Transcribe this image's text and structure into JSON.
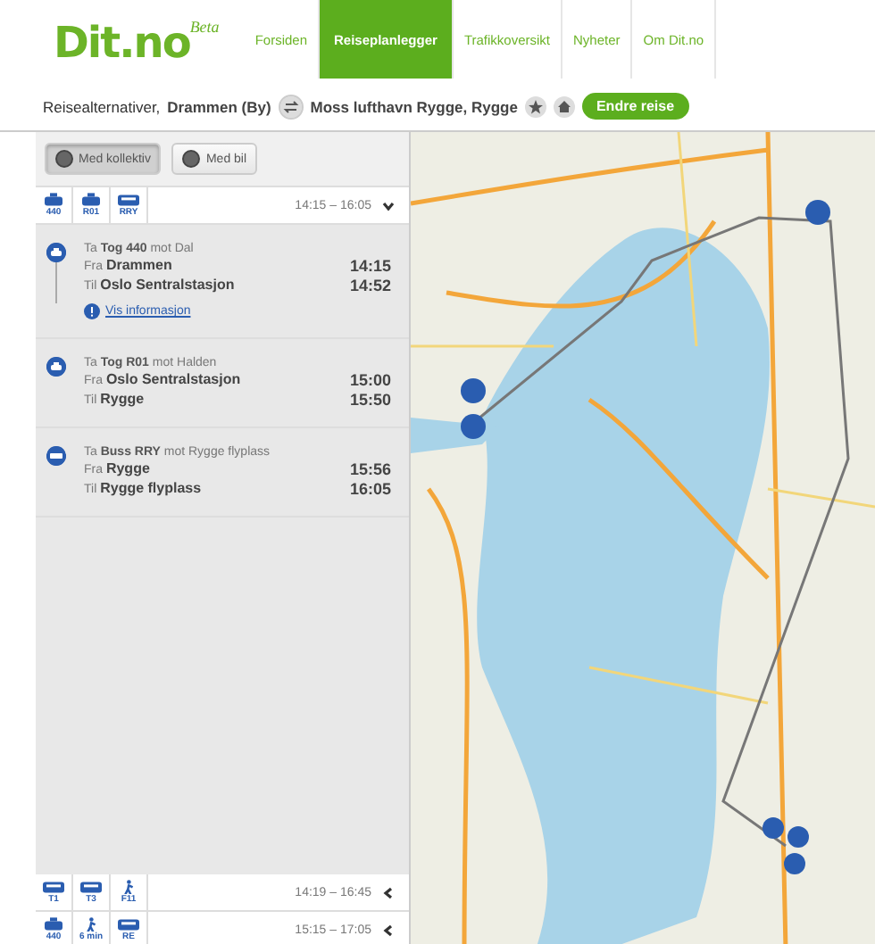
{
  "logo": {
    "text": "Dit.no",
    "badge": "Beta"
  },
  "nav": [
    {
      "label": "Forsiden",
      "selected": false
    },
    {
      "label": "Reiseplanlegger",
      "selected": true
    },
    {
      "label": "Trafikkoversikt",
      "selected": false
    },
    {
      "label": "Nyheter",
      "selected": false
    },
    {
      "label": "Om Dit.no",
      "selected": false
    }
  ],
  "route_bar": {
    "prefix": "Reisealternativer,",
    "from": "Drammen (By)",
    "to": "Moss lufthavn Rygge, Rygge",
    "button": "Endre reise"
  },
  "travel_modes": [
    {
      "label": "Med kollektiv",
      "selected": true
    },
    {
      "label": "Med bil",
      "selected": false
    }
  ],
  "alternatives": [
    {
      "legs": [
        {
          "kind": "train",
          "label": "440"
        },
        {
          "kind": "train",
          "label": "R01"
        },
        {
          "kind": "bus",
          "label": "RRY"
        }
      ],
      "time": "14:15 – 16:05",
      "expanded": true,
      "steps": [
        {
          "kind": "train",
          "text": "Ta **Tog 440** mot Dal",
          "from_label": "Fra",
          "from": "Drammen",
          "departure": "14:15",
          "to_label": "Til",
          "to": "Oslo Sentralstasjon",
          "arrival": "14:52",
          "link": "Vis informasjon"
        },
        {
          "kind": "train",
          "text": "Ta **Tog R01** mot Halden",
          "from_label": "Fra",
          "from": "Oslo Sentralstasjon",
          "departure": "15:00",
          "to_label": "Til",
          "to": "Rygge",
          "arrival": "15:50"
        },
        {
          "kind": "bus",
          "text": "Ta **Buss RRY** mot Rygge flyplass",
          "from_label": "Fra",
          "from": "Rygge",
          "departure": "15:56",
          "to_label": "Til",
          "to": "Rygge flyplass",
          "arrival": "16:05"
        }
      ]
    },
    {
      "legs": [
        {
          "kind": "bus",
          "label": "T1"
        },
        {
          "kind": "bus",
          "label": "T3"
        },
        {
          "kind": "walk",
          "label": "F11"
        }
      ],
      "time": "14:19 – 16:45",
      "expanded": false
    },
    {
      "legs": [
        {
          "kind": "train",
          "label": "440"
        },
        {
          "kind": "walk",
          "label": "6 min"
        },
        {
          "kind": "bus",
          "label": "RE"
        }
      ],
      "time": "15:15 – 17:05",
      "expanded": false
    }
  ]
}
